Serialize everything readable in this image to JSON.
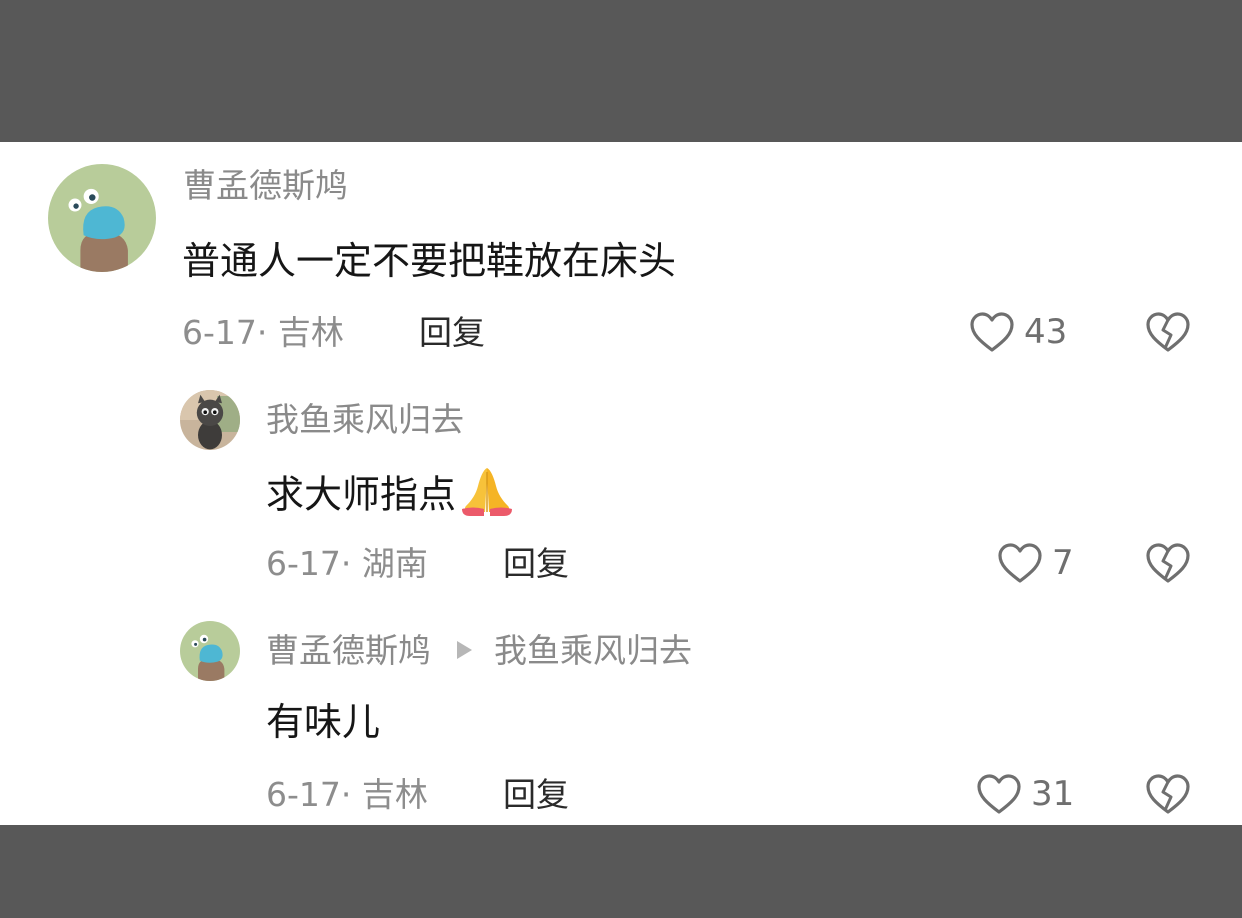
{
  "comments": [
    {
      "username": "曹孟德斯鸠",
      "text": "普通人一定不要把鞋放在床头",
      "date": "6-17",
      "location": "吉林",
      "reply_label": "回复",
      "likes": "43",
      "avatar_icon": "cartoon-avatar-icon"
    },
    {
      "username": "我鱼乘风归去",
      "text": "求大师指点",
      "emoji": "🙏",
      "date": "6-17",
      "location": "湖南",
      "reply_label": "回复",
      "likes": "7",
      "avatar_icon": "cat-avatar-icon"
    },
    {
      "username": "曹孟德斯鸠",
      "reply_to": "我鱼乘风归去",
      "text": "有味儿",
      "date": "6-17",
      "location": "吉林",
      "reply_label": "回复",
      "likes": "31",
      "avatar_icon": "cartoon-avatar-icon"
    }
  ],
  "meta_separator": "·",
  "colors": {
    "background_frame": "#585858",
    "panel": "#ffffff",
    "username": "#8a8a8a",
    "content": "#161616",
    "meta": "#8d8d8d",
    "icon_stroke": "#6f6f6f"
  }
}
